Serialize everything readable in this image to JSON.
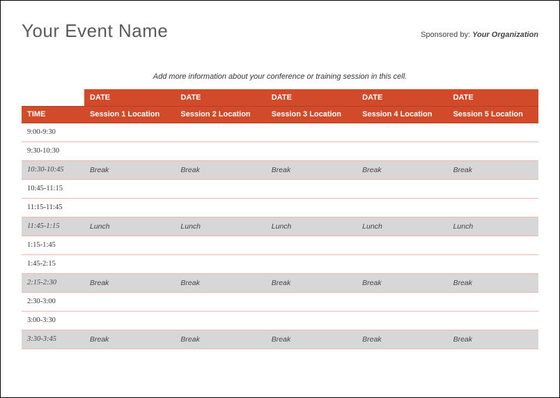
{
  "header": {
    "event_name": "Your Event Name",
    "sponsored_label": "Sponsored by: ",
    "organization": "Your Organization"
  },
  "subtitle": "Add more information about your conference or training session in this cell.",
  "table": {
    "time_header": "TIME",
    "columns": [
      {
        "date": "DATE",
        "location": "Session 1 Location"
      },
      {
        "date": "DATE",
        "location": "Session 2 Location"
      },
      {
        "date": "DATE",
        "location": "Session 3 Location"
      },
      {
        "date": "DATE",
        "location": "Session 4 Location"
      },
      {
        "date": "DATE",
        "location": "Session 5 Location"
      }
    ],
    "rows": [
      {
        "time": "9:00-9:30",
        "shaded": false,
        "cells": [
          "",
          "",
          "",
          "",
          ""
        ]
      },
      {
        "time": "9:30-10:30",
        "shaded": false,
        "cells": [
          "",
          "",
          "",
          "",
          ""
        ]
      },
      {
        "time": "10:30-10:45",
        "shaded": true,
        "cells": [
          "Break",
          "Break",
          "Break",
          "Break",
          "Break"
        ]
      },
      {
        "time": "10:45-11:15",
        "shaded": false,
        "cells": [
          "",
          "",
          "",
          "",
          ""
        ]
      },
      {
        "time": "11:15-11:45",
        "shaded": false,
        "cells": [
          "",
          "",
          "",
          "",
          ""
        ]
      },
      {
        "time": "11:45-1:15",
        "shaded": true,
        "cells": [
          "Lunch",
          "Lunch",
          "Lunch",
          "Lunch",
          "Lunch"
        ]
      },
      {
        "time": "1:15-1:45",
        "shaded": false,
        "cells": [
          "",
          "",
          "",
          "",
          ""
        ]
      },
      {
        "time": "1:45-2:15",
        "shaded": false,
        "cells": [
          "",
          "",
          "",
          "",
          ""
        ]
      },
      {
        "time": "2:15-2:30",
        "shaded": true,
        "cells": [
          "Break",
          "Break",
          "Break",
          "Break",
          "Break"
        ]
      },
      {
        "time": "2:30-3:00",
        "shaded": false,
        "cells": [
          "",
          "",
          "",
          "",
          ""
        ]
      },
      {
        "time": "3:00-3:30",
        "shaded": false,
        "cells": [
          "",
          "",
          "",
          "",
          ""
        ]
      },
      {
        "time": "3:30-3:45",
        "shaded": true,
        "cells": [
          "Break",
          "Break",
          "Break",
          "Break",
          "Break"
        ]
      }
    ]
  }
}
